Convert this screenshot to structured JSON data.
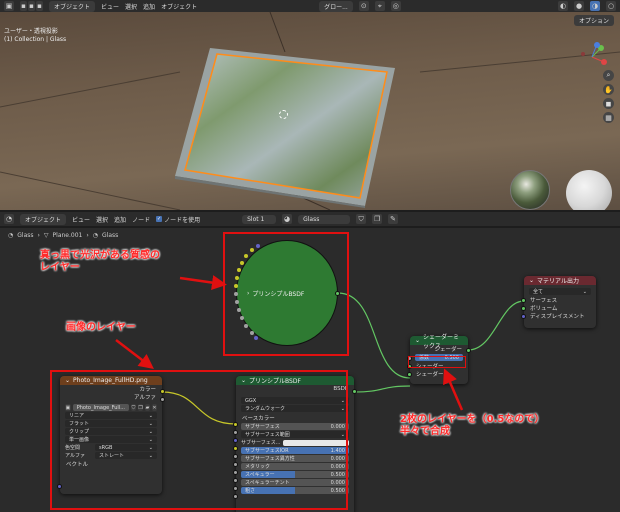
{
  "viewport_header": {
    "mode_label": "オブジェクト",
    "menu": [
      "ビュー",
      "選択",
      "追加",
      "オブジェクト"
    ],
    "orientation": "グロー...",
    "options_label": "オプション"
  },
  "viewport": {
    "view_name": "ユーザー・透視投影",
    "collection_info": "(1) Collection | Glass"
  },
  "node_header": {
    "mode_label": "オブジェクト",
    "menu": [
      "ビュー",
      "選択",
      "追加",
      "ノード"
    ],
    "use_nodes_label": "ノードを使用",
    "slot_label": "Slot 1",
    "material_name": "Glass"
  },
  "breadcrumb": [
    "Glass",
    "Plane.001",
    "Glass"
  ],
  "nodes": {
    "principled_collapsed": {
      "title": "プリンシプルBSDF"
    },
    "material_output": {
      "title": "マテリアル出力",
      "target": "全て",
      "inputs": [
        "サーフェス",
        "ボリューム",
        "ディスプレイスメント"
      ]
    },
    "mix_shader": {
      "title": "シェーダーミックス",
      "output": "シェーダー",
      "factor_label": "係数",
      "factor_value": "0.500",
      "inputs": [
        "シェーダー",
        "シェーダー"
      ]
    },
    "image_texture": {
      "title": "Photo_Image_FullHD.png",
      "outputs": [
        "カラー",
        "アルファ"
      ],
      "image_name": "Photo_Image_Full...",
      "interpolation": "リニア",
      "projection": "フラット",
      "extension": "クリップ",
      "source": "単一画像",
      "colorspace_label": "色空間",
      "colorspace_value": "sRGB",
      "alpha_label": "アルファ",
      "alpha_value": "ストレート",
      "vector_label": "ベクトル"
    },
    "principled": {
      "title": "プリンシプルBSDF",
      "output": "BSDF",
      "distribution": "GGX",
      "subsurface_method": "ランダムウォーク",
      "base_color": "ベースカラー",
      "subsurface": {
        "label": "サブサーフェス",
        "value": "0.000"
      },
      "subsurface_radius": "サブサーフェス範囲",
      "subsurface_color": "サブサーフェス...",
      "subsurface_ior": {
        "label": "サブサーフェスIOR",
        "value": "1.400"
      },
      "subsurface_aniso": {
        "label": "サブサーフェス異方性",
        "value": "0.000"
      },
      "metallic": {
        "label": "メタリック",
        "value": "0.000"
      },
      "specular": {
        "label": "スペキュラー",
        "value": "0.500"
      },
      "specular_tint": {
        "label": "スペキュラーチント",
        "value": "0.000"
      },
      "roughness": {
        "label": "粗さ",
        "value": "0.500"
      }
    }
  },
  "annotations": {
    "dark_layer": [
      "真っ黒で光沢がある質感の",
      "レイヤー"
    ],
    "image_layer": "画像のレイヤー",
    "mix_note": [
      "2枚のレイヤーを（0.5なので）",
      "半々で合成"
    ]
  },
  "colors": {
    "annotation_red": "#e01010",
    "shader_green": "#63c763",
    "color_yellow": "#c7c729",
    "principled_header": "#1e5a32",
    "image_header": "#6e3f1d",
    "output_header": "#6a2930",
    "mix_header": "#1e5a32",
    "selection_orange": "#ff8c1a"
  }
}
